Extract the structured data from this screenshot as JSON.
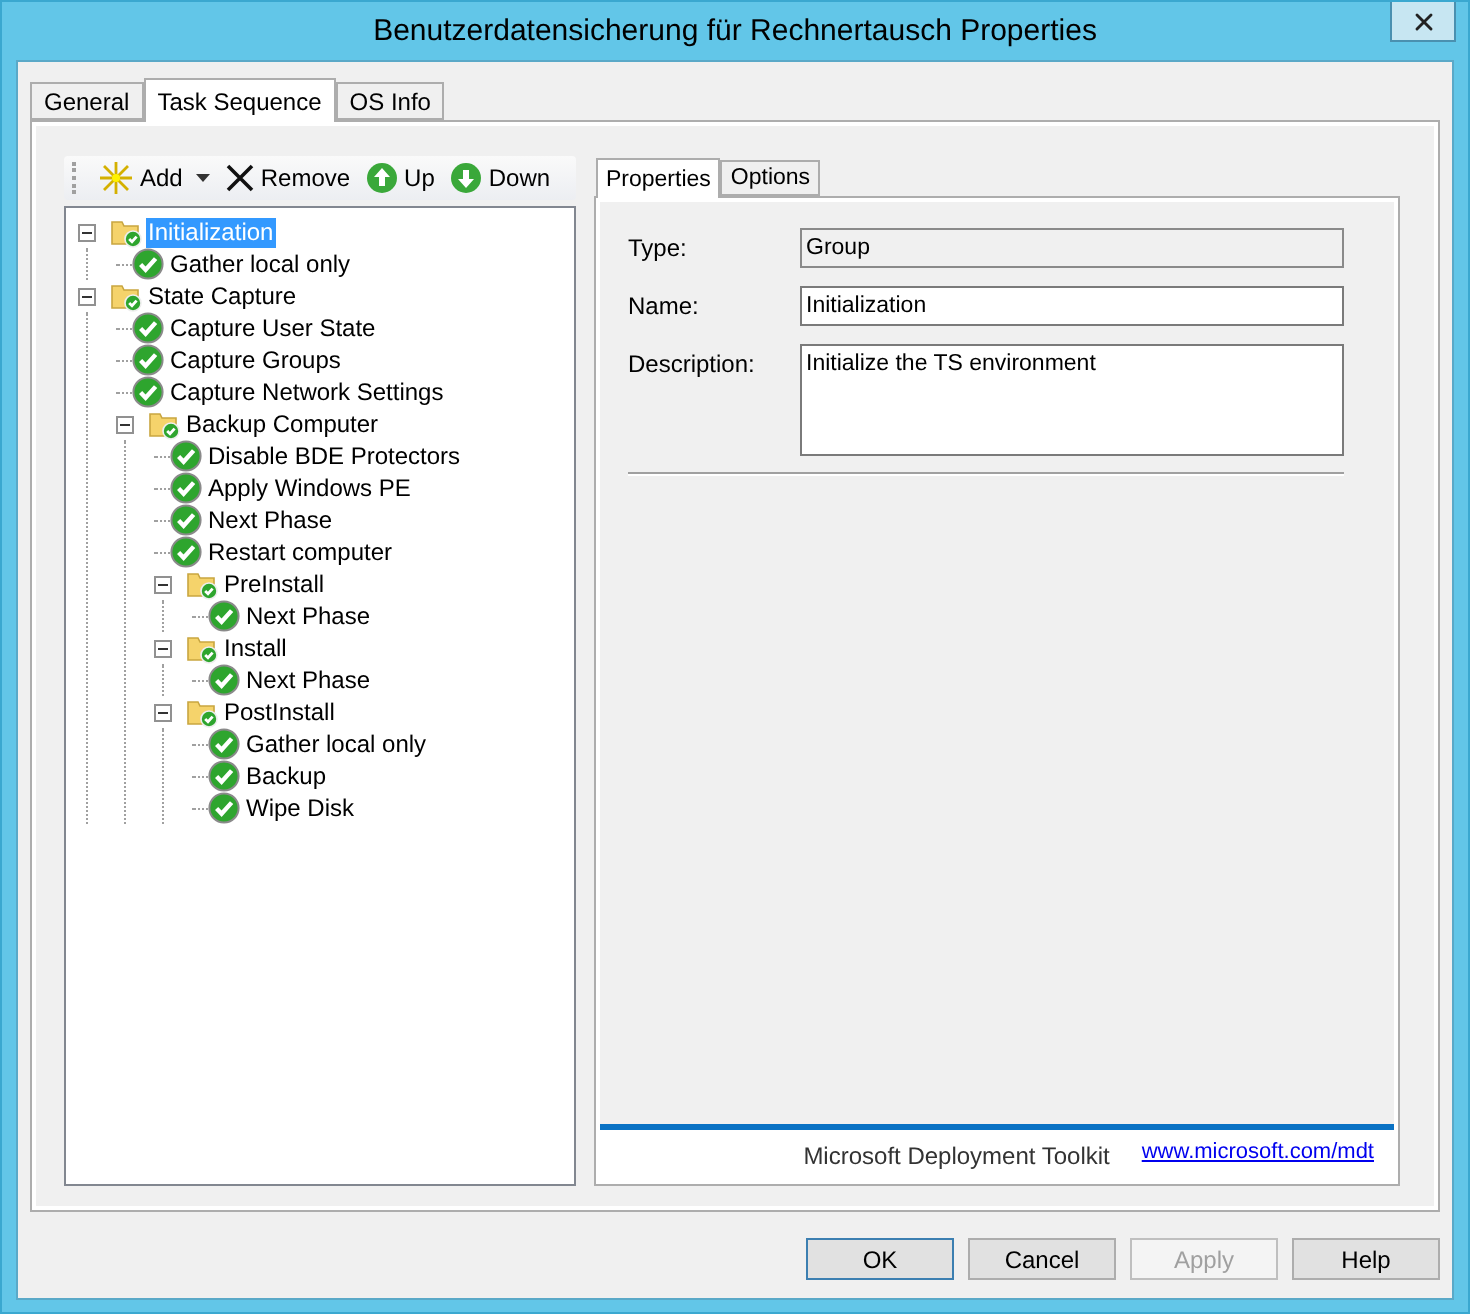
{
  "window": {
    "title": "Benutzerdatensicherung für Rechnertausch Properties"
  },
  "tabs": [
    {
      "label": "General",
      "selected": false
    },
    {
      "label": "Task Sequence",
      "selected": true
    },
    {
      "label": "OS Info",
      "selected": false
    }
  ],
  "toolbar": [
    {
      "kind": "add",
      "label": "Add"
    },
    {
      "kind": "remove",
      "label": "Remove"
    },
    {
      "kind": "up",
      "label": "Up"
    },
    {
      "kind": "down",
      "label": "Down"
    }
  ],
  "tree": [
    {
      "label": "Initialization",
      "kind": "group",
      "expanded": true,
      "selected": true,
      "children": [
        {
          "label": "Gather local only",
          "kind": "step",
          "selected": false
        }
      ]
    },
    {
      "label": "State Capture",
      "kind": "group",
      "expanded": true,
      "selected": false,
      "children": [
        {
          "label": "Capture User State",
          "kind": "step",
          "selected": false
        },
        {
          "label": "Capture Groups",
          "kind": "step",
          "selected": false
        },
        {
          "label": "Capture Network Settings",
          "kind": "step",
          "selected": false
        },
        {
          "label": "Backup Computer",
          "kind": "group",
          "expanded": true,
          "selected": false,
          "children": [
            {
              "label": "Disable BDE Protectors",
              "kind": "step",
              "selected": false
            },
            {
              "label": "Apply Windows PE",
              "kind": "step",
              "selected": false
            },
            {
              "label": "Next Phase",
              "kind": "step",
              "selected": false
            },
            {
              "label": "Restart computer",
              "kind": "step",
              "selected": false
            },
            {
              "label": "PreInstall",
              "kind": "group",
              "expanded": true,
              "selected": false,
              "children": [
                {
                  "label": "Next Phase",
                  "kind": "step",
                  "selected": false
                }
              ]
            },
            {
              "label": "Install",
              "kind": "group",
              "expanded": true,
              "selected": false,
              "children": [
                {
                  "label": "Next Phase",
                  "kind": "step",
                  "selected": false
                }
              ]
            },
            {
              "label": "PostInstall",
              "kind": "group",
              "expanded": true,
              "selected": false,
              "children": [
                {
                  "label": "Gather local only",
                  "kind": "step",
                  "selected": false
                },
                {
                  "label": "Backup",
                  "kind": "step",
                  "selected": false
                },
                {
                  "label": "Wipe Disk",
                  "kind": "step",
                  "selected": false
                }
              ]
            }
          ]
        }
      ]
    }
  ],
  "detail_tabs": [
    {
      "label": "Properties",
      "selected": true
    },
    {
      "label": "Options",
      "selected": false
    }
  ],
  "fields": [
    {
      "label": "Type:",
      "value": "Group",
      "disabled": true,
      "kind": "line"
    },
    {
      "label": "Name:",
      "value": "Initialization",
      "disabled": false,
      "kind": "line"
    },
    {
      "label": "Description:",
      "value": "Initialize the TS environment",
      "kind": "multiline"
    }
  ],
  "footer": {
    "text": "Microsoft Deployment Toolkit",
    "link": "www.microsoft.com/mdt"
  },
  "buttons": [
    {
      "label": "OK",
      "disabled": false,
      "default": true
    },
    {
      "label": "Cancel",
      "disabled": false,
      "default": false
    },
    {
      "label": "Apply",
      "disabled": true,
      "default": false
    },
    {
      "label": "Help",
      "disabled": false,
      "default": false
    }
  ]
}
